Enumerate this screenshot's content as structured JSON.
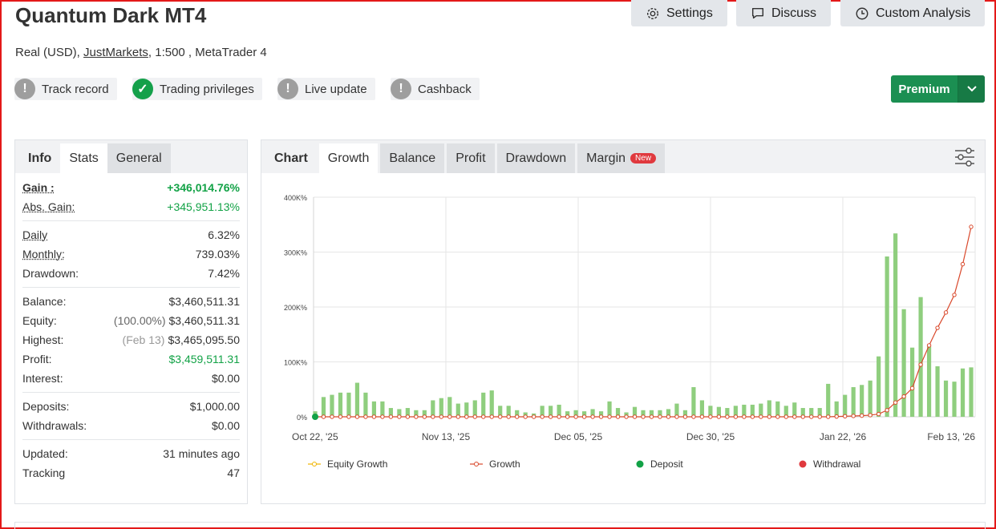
{
  "header": {
    "title": "Quantum Dark MT4",
    "account_type": "Real (USD),",
    "broker": "JustMarkets",
    "leverage_platform": ", 1:500 , MetaTrader 4"
  },
  "toolbar": {
    "settings": "Settings",
    "discuss": "Discuss",
    "custom_analysis": "Custom Analysis"
  },
  "badges": {
    "track_record": "Track record",
    "trading_privileges": "Trading privileges",
    "live_update": "Live update",
    "cashback": "Cashback"
  },
  "premium": {
    "label": "Premium"
  },
  "left_tabs": {
    "info": "Info",
    "stats": "Stats",
    "general": "General"
  },
  "stats": {
    "gain_label": "Gain :",
    "gain_value": "+346,014.76%",
    "abs_gain_label": "Abs. Gain:",
    "abs_gain_value": "+345,951.13%",
    "daily_label": "Daily",
    "daily_value": "6.32%",
    "monthly_label": "Monthly:",
    "monthly_value": "739.03%",
    "drawdown_label": "Drawdown:",
    "drawdown_value": "7.42%",
    "balance_label": "Balance:",
    "balance_value": "$3,460,511.31",
    "equity_label": "Equity:",
    "equity_pct": "(100.00%)",
    "equity_value": "$3,460,511.31",
    "highest_label": "Highest:",
    "highest_date": "(Feb 13)",
    "highest_value": "$3,465,095.50",
    "profit_label": "Profit:",
    "profit_value": "$3,459,511.31",
    "interest_label": "Interest:",
    "interest_value": "$0.00",
    "deposits_label": "Deposits:",
    "deposits_value": "$1,000.00",
    "withdrawals_label": "Withdrawals:",
    "withdrawals_value": "$0.00",
    "updated_label": "Updated:",
    "updated_value": "31 minutes ago",
    "tracking_label": "Tracking",
    "tracking_value": "47"
  },
  "chart_tabs": {
    "chart": "Chart",
    "growth": "Growth",
    "balance": "Balance",
    "profit": "Profit",
    "drawdown": "Drawdown",
    "margin": "Margin",
    "new_badge": "New"
  },
  "legend": {
    "equity_growth": "Equity Growth",
    "growth": "Growth",
    "deposit": "Deposit",
    "withdrawal": "Withdrawal"
  },
  "colors": {
    "bars": "#8fce7e",
    "growth_line": "#d9482b",
    "equity_line": "#f0b400",
    "deposit": "#12a246",
    "withdrawal": "#e0393e",
    "premium": "#1b8f52"
  },
  "chart_data": {
    "type": "bar",
    "ylim": [
      0,
      400000
    ],
    "y_ticks": [
      "0%",
      "100K%",
      "200K%",
      "300K%",
      "400K%"
    ],
    "x_ticks": [
      "Oct 22, '25",
      "Nov 13, '25",
      "Dec 05, '25",
      "Dec 30, '25",
      "Jan 22, '26",
      "Feb 13, '26"
    ],
    "bars": [
      10000,
      36000,
      40000,
      44000,
      44000,
      62000,
      44000,
      28000,
      28000,
      16000,
      14000,
      16000,
      12000,
      12000,
      30000,
      34000,
      36000,
      24000,
      26000,
      30000,
      44000,
      48000,
      20000,
      20000,
      12000,
      8000,
      6000,
      20000,
      20000,
      22000,
      10000,
      12000,
      10000,
      14000,
      10000,
      28000,
      16000,
      8000,
      18000,
      12000,
      12000,
      12000,
      14000,
      24000,
      12000,
      54000,
      30000,
      20000,
      18000,
      16000,
      20000,
      22000,
      22000,
      24000,
      30000,
      28000,
      20000,
      26000,
      16000,
      16000,
      16000,
      60000,
      28000,
      40000,
      54000,
      58000,
      66000,
      110000,
      292000,
      334000,
      196000,
      126000,
      218000,
      128000,
      92000,
      66000,
      64000,
      88000,
      90000
    ],
    "growth": [
      0,
      0,
      0,
      0,
      0,
      0,
      0,
      0,
      0,
      0,
      0,
      0,
      0,
      0,
      0,
      0,
      0,
      0,
      0,
      0,
      0,
      0,
      0,
      0,
      0,
      0,
      0,
      0,
      0,
      0,
      0,
      0,
      0,
      0,
      0,
      0,
      0,
      0,
      0,
      0,
      0,
      0,
      0,
      0,
      0,
      0,
      0,
      0,
      0,
      0,
      0,
      0,
      0,
      0,
      0,
      0,
      0,
      0,
      0,
      0,
      0,
      0,
      500,
      1000,
      1500,
      2000,
      3000,
      5000,
      12000,
      26000,
      37000,
      52000,
      95000,
      130000,
      162000,
      190000,
      222000,
      278000,
      346000
    ],
    "deposit": [
      1000
    ]
  }
}
